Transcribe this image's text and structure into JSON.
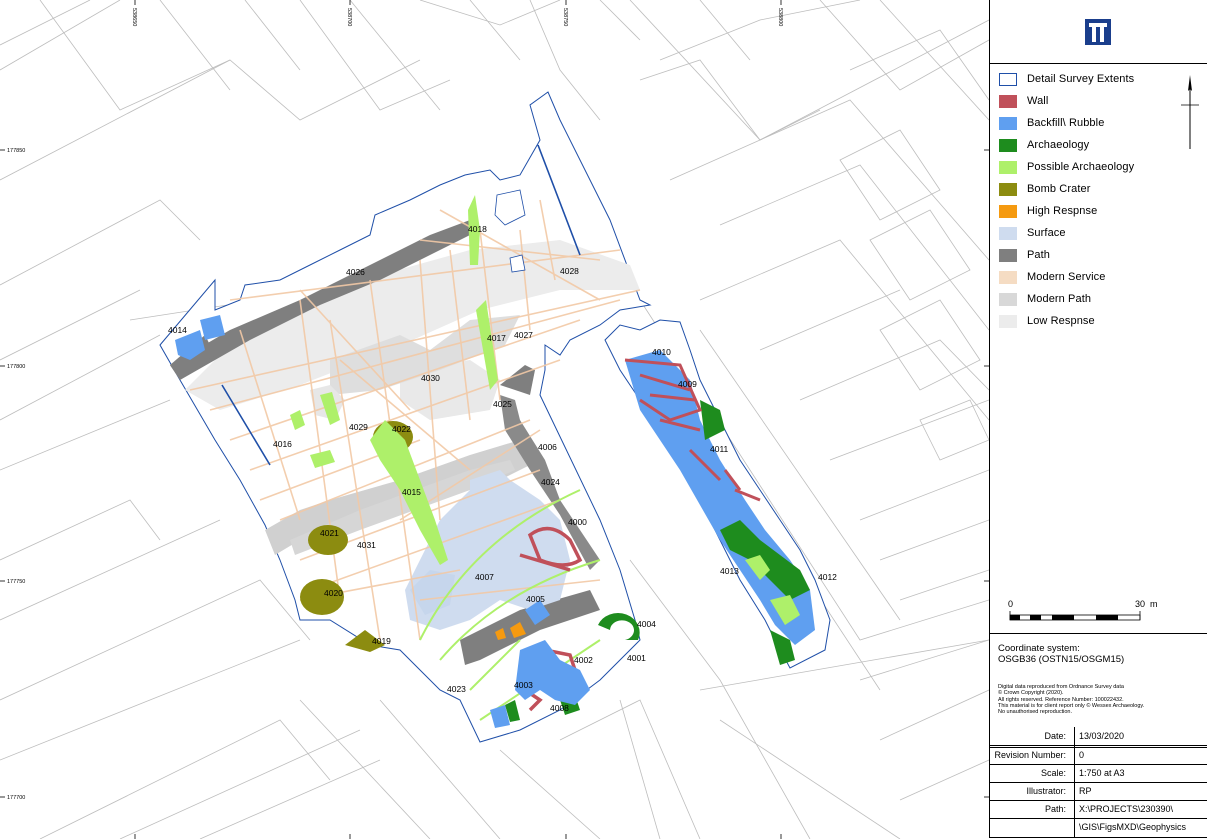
{
  "map": {
    "grid_x_labels": [
      "538650",
      "538700",
      "538750",
      "538800"
    ],
    "grid_y_labels": [
      "177850",
      "177800",
      "177750",
      "177700"
    ],
    "feature_labels": [
      "4014",
      "4026",
      "4018",
      "4028",
      "4017",
      "4027",
      "4010",
      "4009",
      "4030",
      "4025",
      "4016",
      "4029",
      "4022",
      "4006",
      "4011",
      "4024",
      "4015",
      "4000",
      "4021",
      "4031",
      "4007",
      "4013",
      "4012",
      "4020",
      "4005",
      "4004",
      "4019",
      "4002",
      "4001",
      "4003",
      "4023",
      "4008"
    ]
  },
  "logo": {
    "name": "wessex-archaeology-logo",
    "color": "#1a3e8c"
  },
  "legend": {
    "items": [
      {
        "label": "Detail Survey Extents",
        "color": "#ffffff",
        "border": "#1f4fa8"
      },
      {
        "label": "Wall",
        "color": "#c0505a"
      },
      {
        "label": "Backfill\\ Rubble",
        "color": "#5f9ff0"
      },
      {
        "label": "Archaeology",
        "color": "#1e8c1e"
      },
      {
        "label": "Possible Archaeology",
        "color": "#aef06a"
      },
      {
        "label": "Bomb Crater",
        "color": "#8c8c10"
      },
      {
        "label": "High Respnse",
        "color": "#f59a10"
      },
      {
        "label": "Surface",
        "color": "#cfdcef"
      },
      {
        "label": "Path",
        "color": "#7f7f7f"
      },
      {
        "label": "Modern Service",
        "color": "#f5dcc3"
      },
      {
        "label": "Modern Path",
        "color": "#d8d8d8"
      },
      {
        "label": "Low Respnse",
        "color": "#ececec"
      }
    ],
    "north_arrow_icon": "north-arrow-icon",
    "scale_start": "0",
    "scale_end": "30",
    "scale_unit": "m"
  },
  "coordinate_system": {
    "title": "Coordinate system:",
    "value": "OSGB36 (OSTN15/OSGM15)"
  },
  "copyright": [
    "Digital data reproduced from Ordnance Survey data",
    "© Crown Copyright (2020).",
    "All rights reserved. Reference Number: 100022432.",
    "This material is for client report only © Wessex Archaeology.",
    "No unauthorised reproduction."
  ],
  "info": {
    "date_label": "Date:",
    "date": "13/03/2020",
    "revision_label": "Revision Number:",
    "revision": "0",
    "scale_label": "Scale:",
    "scale": "1:750 at A3",
    "illustrator_label": "Illustrator:",
    "illustrator": "RP",
    "path_label": "Path:",
    "path_1": "X:\\PROJECTS\\230390\\",
    "path_2": "\\GIS\\FigsMXD\\Geophysics"
  }
}
